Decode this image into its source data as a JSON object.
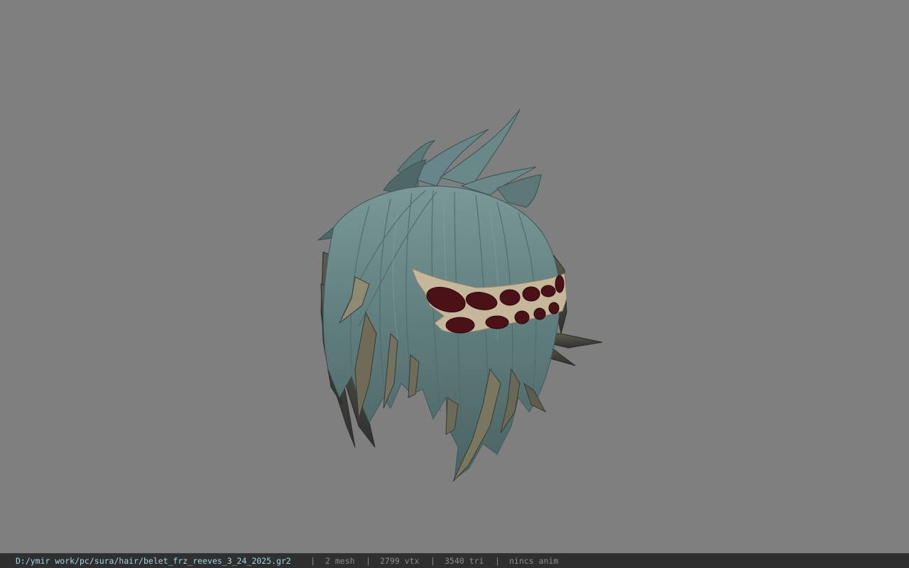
{
  "viewer": {
    "model_description": "teal spiky hair mesh with leaf headband",
    "colors": {
      "background": "#7f7f7f",
      "hair": "#5f7c7c",
      "hair_dark": "#465d5e",
      "hair_light": "#7a9898",
      "headband_leaf": "#c7b79a",
      "headband_spot": "#4a1216"
    }
  },
  "status_bar": {
    "file_path": "D:/ymir work/pc/sura/hair/belet_frz_reeves_3_24_2025.gr2",
    "separator": "|",
    "mesh_count": "2 mesh",
    "vertex_count": "2799 vtx",
    "triangle_count": "3540 tri",
    "animation": "nincs anim"
  }
}
